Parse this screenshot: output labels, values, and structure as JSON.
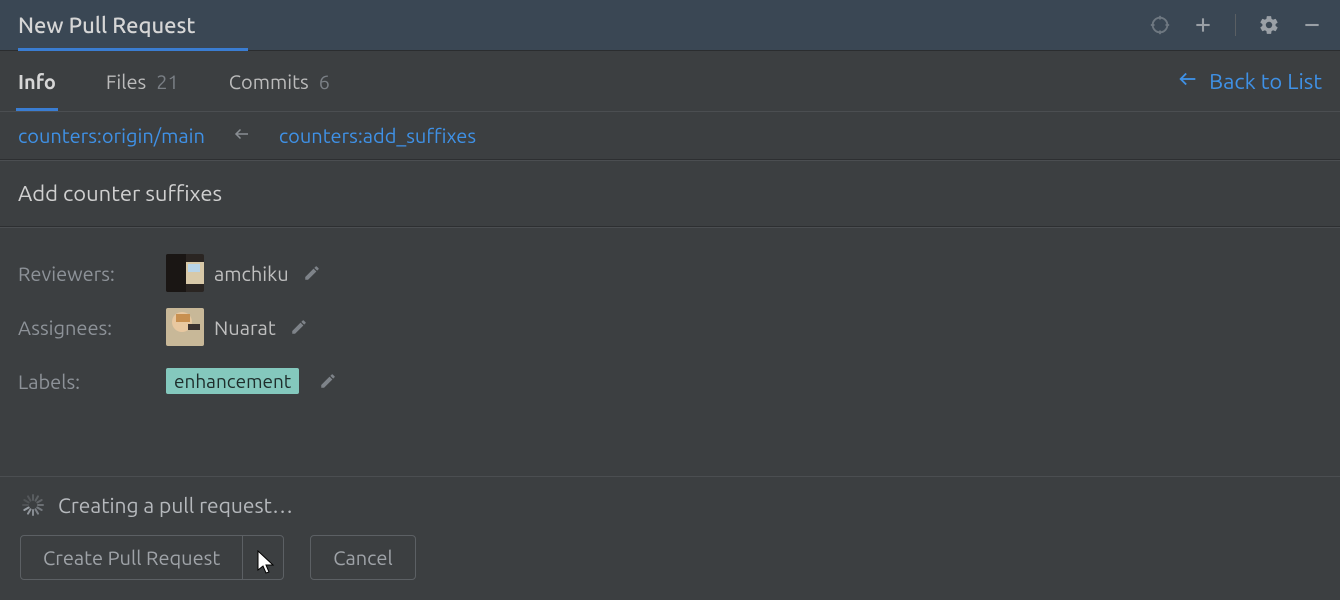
{
  "header": {
    "title": "New Pull Request"
  },
  "tabs": {
    "info": "Info",
    "files": "Files",
    "files_count": "21",
    "commits": "Commits",
    "commits_count": "6"
  },
  "back_link": "Back to List",
  "branches": {
    "base": "counters:origin/main",
    "compare": "counters:add_suffixes"
  },
  "title_value": "Add counter suffixes",
  "meta": {
    "reviewers_label": "Reviewers:",
    "reviewer": "amchiku",
    "assignees_label": "Assignees:",
    "assignee": "Nuarat",
    "labels_label": "Labels:",
    "label_chip": "enhancement"
  },
  "status_text": "Creating a pull request…",
  "buttons": {
    "create": "Create Pull Request",
    "cancel": "Cancel"
  },
  "colors": {
    "link": "#3f91e6",
    "accent": "#3a7dd2",
    "chip": "#84c8bd"
  }
}
